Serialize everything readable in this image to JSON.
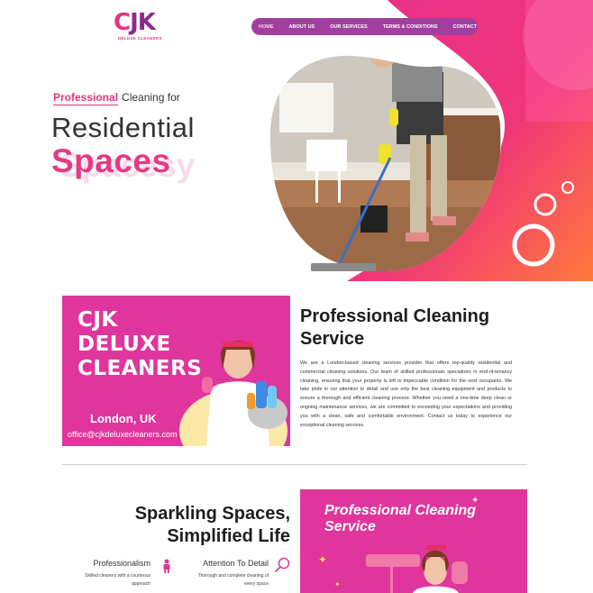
{
  "brand": {
    "logo_text_c": "C",
    "logo_text_rest": "JK",
    "logo_sub": "DELUXE CLEANERS"
  },
  "nav": {
    "items": [
      "HOME",
      "ABOUT US",
      "OUR SERVICES",
      "TERMS & CONDITIONS",
      "CONTACT"
    ]
  },
  "hero": {
    "kicker_highlight": "Professional",
    "kicker_rest": "Cleaning for",
    "title": "Residential",
    "title_ghost": "Residential",
    "spaces": "Spaces",
    "spaces_ghost": "Spacesy"
  },
  "about": {
    "banner_title_1": "CJK",
    "banner_title_2": "DELUXE",
    "banner_title_3": "CLEANERS",
    "city": "London, UK",
    "email": "office@cjkdeluxecleaners.com",
    "heading_1": "Professional Cleaning",
    "heading_2": "Service",
    "body": "We are a London-based cleaning services provider that offers top-quality residential and commercial cleaning solutions. Our team of skilled professionals specializes in end-of-tenancy cleaning, ensuring that your property is left in impeccable condition for the next occupants. We take pride in our attention to detail and use only the best cleaning equipment and products to ensure a thorough and efficient cleaning process. Whether you need a one-time deep clean or ongoing maintenance services, we are committed to exceeding your expectations and providing you with a clean, safe and comfortable environment. Contact us today to experience our exceptional cleaning services."
  },
  "features": {
    "heading_1": "Sparkling Spaces,",
    "heading_2": "Simplified Life",
    "items": [
      {
        "title": "Professionalism",
        "desc_1": "Skilled cleaners with a courteous",
        "desc_2": "approach",
        "icon": "person-icon"
      },
      {
        "title": "Attention To Detail",
        "desc_1": "Thorough and complete cleaning of",
        "desc_2": "every space",
        "icon": "magnifier-icon"
      }
    ],
    "banner_title_1": "Professional Cleaning",
    "banner_title_2": "Service"
  },
  "colors": {
    "magenta": "#e0359c",
    "pink": "#e43a83",
    "purple": "#a13f9e",
    "orange": "#ff6a3d"
  }
}
